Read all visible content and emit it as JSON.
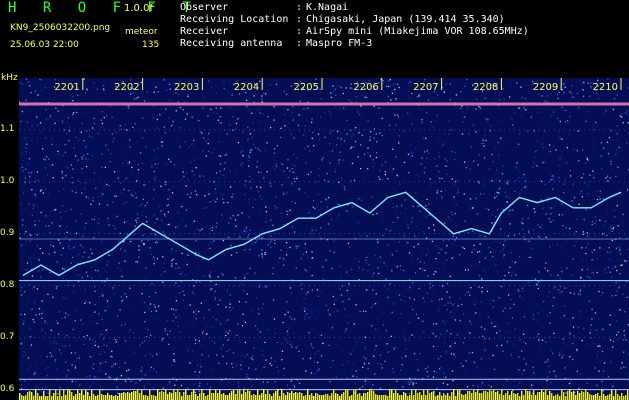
{
  "header": {
    "app_title": "H R O F F T",
    "version": "1.0.0f",
    "filename": "KN9_2506032200.png",
    "meteor_label": "meteor",
    "datetime": "25.06.03 22:00",
    "meteor_count": "135"
  },
  "info": [
    {
      "label": "Observer",
      "value": "K.Nagai"
    },
    {
      "label": "Receiving Location",
      "value": "Chigasaki, Japan (139.414 35.340)"
    },
    {
      "label": "Receiver",
      "value": "AirSpy mini (Miakejima VOR 108.65MHz)"
    },
    {
      "label": "Receiving antenna",
      "value": "Maspro FM-3"
    }
  ],
  "colors": {
    "title": "#33ff33",
    "text_yellow": "#ffff55",
    "trace": "#7fe8ff",
    "noise_base": "#0a1a7a"
  },
  "chart_data": {
    "type": "spectrogram",
    "ylabel": "kHz",
    "ylim": [
      0.58,
      1.2
    ],
    "yticks": [
      0.6,
      0.7,
      0.8,
      0.9,
      1.0,
      1.1
    ],
    "ytick_labels": [
      "0.6",
      "0.7",
      "0.8",
      "0.9",
      "1.0",
      "1.1"
    ],
    "xlim": [
      2200,
      2210
    ],
    "xticks": [
      2201,
      2202,
      2203,
      2204,
      2205,
      2206,
      2207,
      2208,
      2209,
      2210
    ],
    "xtick_labels": [
      "2201",
      "2202",
      "2203",
      "2204",
      "2205",
      "2206",
      "2207",
      "2208",
      "2209",
      "2210"
    ],
    "constant_lines_khz": [
      1.15,
      0.89,
      0.81,
      0.62,
      0.6
    ],
    "trace": {
      "x": [
        2200.0,
        2200.3,
        2200.6,
        2200.9,
        2201.2,
        2201.5,
        2201.8,
        2202.0,
        2202.3,
        2202.6,
        2202.9,
        2203.1,
        2203.4,
        2203.7,
        2204.0,
        2204.3,
        2204.6,
        2204.9,
        2205.2,
        2205.5,
        2205.8,
        2206.1,
        2206.4,
        2206.7,
        2207.0,
        2207.2,
        2207.5,
        2207.8,
        2208.0,
        2208.3,
        2208.6,
        2208.9,
        2209.2,
        2209.5,
        2209.8,
        2210.0
      ],
      "y": [
        0.82,
        0.84,
        0.82,
        0.84,
        0.85,
        0.87,
        0.9,
        0.92,
        0.9,
        0.88,
        0.86,
        0.85,
        0.87,
        0.88,
        0.9,
        0.91,
        0.93,
        0.93,
        0.95,
        0.96,
        0.94,
        0.97,
        0.98,
        0.95,
        0.92,
        0.9,
        0.91,
        0.9,
        0.94,
        0.97,
        0.96,
        0.97,
        0.95,
        0.95,
        0.97,
        0.98
      ]
    }
  }
}
